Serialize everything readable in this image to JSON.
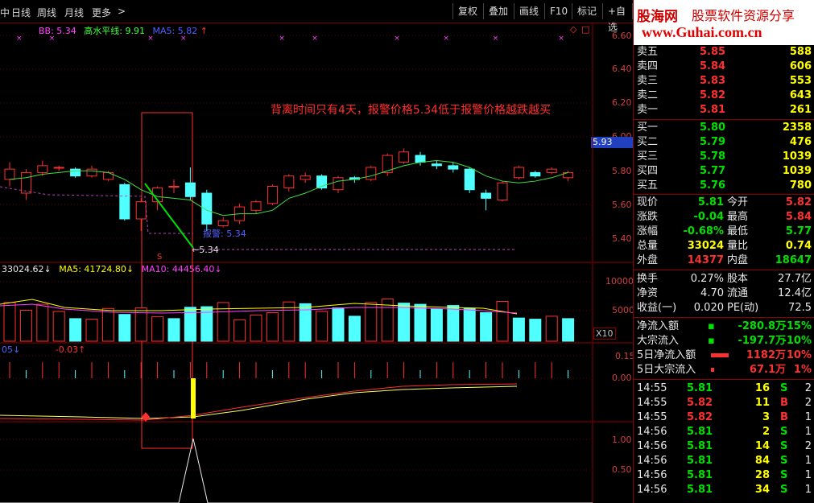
{
  "toolbar": {
    "tabs": [
      "中",
      "日线",
      "周线",
      "月线",
      "更多"
    ],
    "more_arrow": ">",
    "buttons": [
      "复权",
      "叠加",
      "画线",
      "F10",
      "标记",
      "+自选"
    ]
  },
  "main_chart": {
    "legend": {
      "bb": "BB: 5.34",
      "hs": "高水平线: 9.91",
      "ma5": "MA5: 5.82",
      "ma5_arrow": "↑"
    },
    "annotation": "背离时间只有4天，报警价格5.34低于报警价格越跌越买",
    "alert_label": "报警: 5.34",
    "low_label": "←5.34",
    "marker": "S",
    "y_ticks": [
      "6.60",
      "6.40",
      "6.20",
      "6.00",
      "5.80",
      "5.60",
      "5.40"
    ],
    "current_price_tag": "5.93",
    "corner_icon": "◇",
    "corner_icon2": "□"
  },
  "volume_chart": {
    "legend": {
      "v": "33024.62↓",
      "ma5": "MA5: 41724.80↓",
      "ma10": "MA10: 44456.40↓"
    },
    "y_ticks": [
      "10000",
      "5000"
    ],
    "multiplier": "X10"
  },
  "indicator1": {
    "legend": {
      "a": "05↓",
      "b": "-0.03↑"
    },
    "y_ticks": [
      "0.15",
      "0.00"
    ]
  },
  "indicator2": {
    "y_ticks": [
      "1.00",
      "0.50"
    ]
  },
  "logo": {
    "name": "股海网",
    "slogan": "股票软件资源分享",
    "url": "www.Guhai.com.cn"
  },
  "order_book": {
    "asks": [
      {
        "label": "卖五",
        "price": "5.85",
        "vol": "588"
      },
      {
        "label": "卖四",
        "price": "5.84",
        "vol": "606"
      },
      {
        "label": "卖三",
        "price": "5.83",
        "vol": "553"
      },
      {
        "label": "卖二",
        "price": "5.82",
        "vol": "643"
      },
      {
        "label": "卖一",
        "price": "5.81",
        "vol": "261"
      }
    ],
    "bids": [
      {
        "label": "买一",
        "price": "5.80",
        "vol": "2358"
      },
      {
        "label": "买二",
        "price": "5.79",
        "vol": "476"
      },
      {
        "label": "买三",
        "price": "5.78",
        "vol": "1039"
      },
      {
        "label": "买四",
        "price": "5.77",
        "vol": "1039"
      },
      {
        "label": "买五",
        "price": "5.76",
        "vol": "780"
      }
    ]
  },
  "quote": [
    {
      "l1": "现价",
      "v1": "5.81",
      "l2": "今开",
      "v2": "5.82"
    },
    {
      "l1": "涨跌",
      "v1": "-0.04",
      "l2": "最高",
      "v2": "5.84"
    },
    {
      "l1": "涨幅",
      "v1": "-0.68%",
      "l2": "最低",
      "v2": "5.77"
    },
    {
      "l1": "总量",
      "v1": "33024",
      "l2": "量比",
      "v2": "0.74"
    },
    {
      "l1": "外盘",
      "v1": "14377",
      "l2": "内盘",
      "v2": "18647"
    }
  ],
  "fundamentals": [
    {
      "l1": "换手",
      "v1": "0.27%",
      "l2": "股本",
      "v2": "27.7亿"
    },
    {
      "l1": "净资",
      "v1": "4.70",
      "l2": "流通",
      "v2": "12.4亿"
    },
    {
      "l1": "收益(一)",
      "v1": "0.020",
      "l2": "PE(动)",
      "v2": "72.5"
    }
  ],
  "flows": [
    {
      "label": "净流入额",
      "bar": "▪",
      "value": "-280.8万",
      "pct": "-15%"
    },
    {
      "label": "大宗流入",
      "bar": "▪",
      "value": "-197.7万",
      "pct": "-10%"
    },
    {
      "label": "5日净流入额",
      "bar": "",
      "value": "1182万",
      "pct": "10%"
    },
    {
      "label": "5日大宗流入",
      "bar": "",
      "value": "67.1万",
      "pct": "1%"
    }
  ],
  "ticks": [
    {
      "time": "14:55",
      "price": "5.81",
      "vol": "16",
      "side": "S",
      "n": "2"
    },
    {
      "time": "14:55",
      "price": "5.82",
      "vol": "11",
      "side": "B",
      "n": "2"
    },
    {
      "time": "14:55",
      "price": "5.82",
      "vol": "3",
      "side": "B",
      "n": "1"
    },
    {
      "time": "14:56",
      "price": "5.81",
      "vol": "2",
      "side": "S",
      "n": "1"
    },
    {
      "time": "14:56",
      "price": "5.81",
      "vol": "14",
      "side": "S",
      "n": "2"
    },
    {
      "time": "14:56",
      "price": "5.81",
      "vol": "84",
      "side": "S",
      "n": "1"
    },
    {
      "time": "14:56",
      "price": "5.81",
      "vol": "28",
      "side": "S",
      "n": "1"
    },
    {
      "time": "14:56",
      "price": "5.81",
      "vol": "34",
      "side": "S",
      "n": "1"
    }
  ],
  "chart_data": {
    "type": "candlestick",
    "y_range": [
      5.3,
      6.7
    ],
    "candles": [
      {
        "o": 5.78,
        "c": 5.84,
        "h": 5.88,
        "l": 5.74,
        "up": true
      },
      {
        "o": 5.7,
        "c": 5.82,
        "h": 5.84,
        "l": 5.66,
        "up": true
      },
      {
        "o": 5.82,
        "c": 5.86,
        "h": 5.89,
        "l": 5.8,
        "up": true
      },
      {
        "o": 5.85,
        "c": 5.85,
        "h": 5.86,
        "l": 5.83,
        "up": true
      },
      {
        "o": 5.84,
        "c": 5.8,
        "h": 5.85,
        "l": 5.79,
        "up": false
      },
      {
        "o": 5.8,
        "c": 5.84,
        "h": 5.86,
        "l": 5.79,
        "up": true
      },
      {
        "o": 5.78,
        "c": 5.82,
        "h": 5.83,
        "l": 5.77,
        "up": true
      },
      {
        "o": 5.75,
        "c": 5.55,
        "h": 5.76,
        "l": 5.54,
        "up": false
      },
      {
        "o": 5.55,
        "c": 5.65,
        "h": 5.67,
        "l": 5.48,
        "up": true
      },
      {
        "o": 5.65,
        "c": 5.73,
        "h": 5.74,
        "l": 5.6,
        "up": true
      },
      {
        "o": 5.74,
        "c": 5.74,
        "h": 5.78,
        "l": 5.7,
        "up": true
      },
      {
        "o": 5.76,
        "c": 5.68,
        "h": 5.85,
        "l": 5.66,
        "up": false
      },
      {
        "o": 5.7,
        "c": 5.52,
        "h": 5.72,
        "l": 5.48,
        "up": false
      },
      {
        "o": 5.51,
        "c": 5.54,
        "h": 5.56,
        "l": 5.5,
        "up": true
      },
      {
        "o": 5.54,
        "c": 5.62,
        "h": 5.64,
        "l": 5.52,
        "up": true
      },
      {
        "o": 5.6,
        "c": 5.65,
        "h": 5.66,
        "l": 5.58,
        "up": true
      },
      {
        "o": 5.64,
        "c": 5.74,
        "h": 5.75,
        "l": 5.63,
        "up": true
      },
      {
        "o": 5.73,
        "c": 5.8,
        "h": 5.81,
        "l": 5.71,
        "up": true
      },
      {
        "o": 5.78,
        "c": 5.8,
        "h": 5.82,
        "l": 5.76,
        "up": true
      },
      {
        "o": 5.8,
        "c": 5.73,
        "h": 5.81,
        "l": 5.72,
        "up": false
      },
      {
        "o": 5.72,
        "c": 5.79,
        "h": 5.8,
        "l": 5.7,
        "up": true
      },
      {
        "o": 5.79,
        "c": 5.78,
        "h": 5.8,
        "l": 5.76,
        "up": false
      },
      {
        "o": 5.78,
        "c": 5.85,
        "h": 5.86,
        "l": 5.77,
        "up": true
      },
      {
        "o": 5.82,
        "c": 5.92,
        "h": 5.93,
        "l": 5.8,
        "up": true
      },
      {
        "o": 5.88,
        "c": 5.94,
        "h": 5.96,
        "l": 5.87,
        "up": true
      },
      {
        "o": 5.92,
        "c": 5.88,
        "h": 5.94,
        "l": 5.86,
        "up": false
      },
      {
        "o": 5.87,
        "c": 5.86,
        "h": 5.89,
        "l": 5.84,
        "up": false
      },
      {
        "o": 5.86,
        "c": 5.84,
        "h": 5.88,
        "l": 5.82,
        "up": false
      },
      {
        "o": 5.84,
        "c": 5.72,
        "h": 5.85,
        "l": 5.7,
        "up": false
      },
      {
        "o": 5.7,
        "c": 5.67,
        "h": 5.72,
        "l": 5.6,
        "up": false
      },
      {
        "o": 5.66,
        "c": 5.76,
        "h": 5.77,
        "l": 5.65,
        "up": true
      },
      {
        "o": 5.79,
        "c": 5.85,
        "h": 5.86,
        "l": 5.78,
        "up": true
      },
      {
        "o": 5.82,
        "c": 5.8,
        "h": 5.83,
        "l": 5.79,
        "up": false
      },
      {
        "o": 5.82,
        "c": 5.84,
        "h": 5.85,
        "l": 5.81,
        "up": true
      },
      {
        "o": 5.79,
        "c": 5.82,
        "h": 5.83,
        "l": 5.77,
        "up": true
      }
    ],
    "volumes": [
      {
        "v": 6500,
        "up": true
      },
      {
        "v": 5200,
        "up": true
      },
      {
        "v": 6200,
        "up": true
      },
      {
        "v": 5000,
        "up": true
      },
      {
        "v": 3800,
        "up": false
      },
      {
        "v": 3700,
        "up": true
      },
      {
        "v": 5500,
        "up": true
      },
      {
        "v": 4500,
        "up": false
      },
      {
        "v": 5600,
        "up": true
      },
      {
        "v": 4100,
        "up": true
      },
      {
        "v": 3800,
        "up": false
      },
      {
        "v": 5700,
        "up": false
      },
      {
        "v": 5800,
        "up": false
      },
      {
        "v": 6500,
        "up": true
      },
      {
        "v": 3600,
        "up": true
      },
      {
        "v": 4400,
        "up": true
      },
      {
        "v": 4800,
        "up": true
      },
      {
        "v": 6600,
        "up": true
      },
      {
        "v": 6300,
        "up": false
      },
      {
        "v": 5000,
        "up": true
      },
      {
        "v": 5600,
        "up": false
      },
      {
        "v": 4200,
        "up": false
      },
      {
        "v": 6500,
        "up": true
      },
      {
        "v": 7100,
        "up": true
      },
      {
        "v": 6400,
        "up": false
      },
      {
        "v": 6200,
        "up": false
      },
      {
        "v": 5400,
        "up": false
      },
      {
        "v": 6000,
        "up": false
      },
      {
        "v": 5500,
        "up": false
      },
      {
        "v": 4800,
        "up": false
      },
      {
        "v": 6700,
        "up": true
      },
      {
        "v": 3900,
        "up": false
      },
      {
        "v": 3700,
        "up": false
      },
      {
        "v": 4200,
        "up": true
      },
      {
        "v": 3800,
        "up": false
      }
    ],
    "ma5": [
      5.78,
      5.79,
      5.81,
      5.82,
      5.83,
      5.83,
      5.82,
      5.78,
      5.72,
      5.68,
      5.67,
      5.66,
      5.6,
      5.57,
      5.58,
      5.58,
      5.6,
      5.67,
      5.7,
      5.74,
      5.77,
      5.78,
      5.8,
      5.83,
      5.86,
      5.88,
      5.89,
      5.88,
      5.85,
      5.8,
      5.77,
      5.76,
      5.77,
      5.79,
      5.82
    ]
  }
}
